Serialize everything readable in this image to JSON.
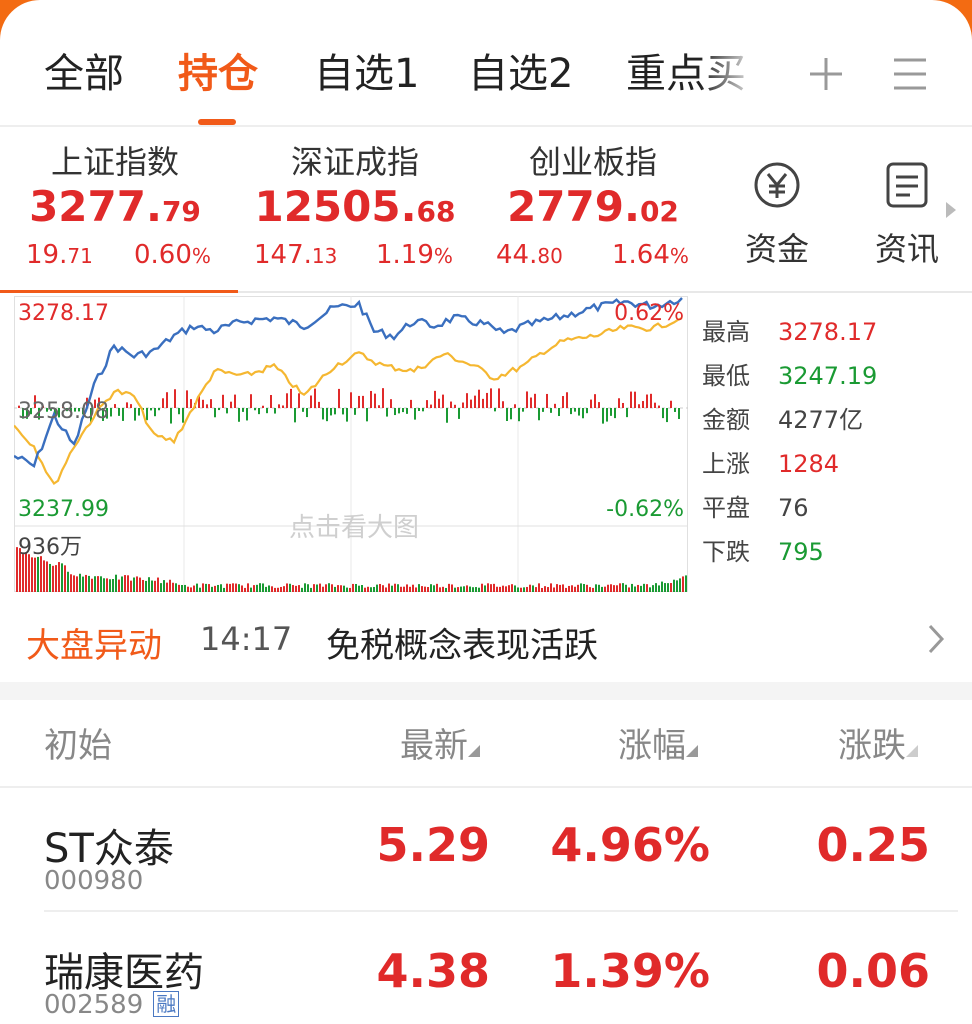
{
  "tabs": [
    {
      "label": "全部",
      "active": false
    },
    {
      "label": "持仓",
      "active": true
    },
    {
      "label": "自选1",
      "active": false
    },
    {
      "label": "自选2",
      "active": false
    },
    {
      "label": "重点买",
      "active": false
    }
  ],
  "icons": {
    "add": "plus-icon",
    "menu": "menu-icon",
    "capital": "yen-icon",
    "news": "document-icon"
  },
  "indices": [
    {
      "name": "上证指数",
      "price_int": "3277.",
      "price_dec": "79",
      "chg_int": "19.",
      "chg_dec": "71",
      "pct": "0.60",
      "pct_sign": "%"
    },
    {
      "name": "深证成指",
      "price_int": "12505.",
      "price_dec": "68",
      "chg_int": "147.",
      "chg_dec": "13",
      "pct": "1.19",
      "pct_sign": "%"
    },
    {
      "name": "创业板指",
      "price_int": "2779.",
      "price_dec": "02",
      "chg_int": "44.",
      "chg_dec": "80",
      "pct": "1.64",
      "pct_sign": "%"
    }
  ],
  "side_buttons": {
    "capital": "资金",
    "news": "资讯"
  },
  "chart": {
    "high_label": "3278.17",
    "mid_label": "3258.08",
    "low_label": "3237.99",
    "pos_pct": "0.62%",
    "neg_pct": "-0.62%",
    "volume_label": "936万",
    "watermark": "点击看大图"
  },
  "stats": [
    {
      "label": "最高",
      "value": "3278.17",
      "color": "#e02a2a"
    },
    {
      "label": "最低",
      "value": "3247.19",
      "color": "#1a9a33"
    },
    {
      "label": "金额",
      "value": "4277亿",
      "color": "#444444"
    },
    {
      "label": "上涨",
      "value": "1284",
      "color": "#e02a2a"
    },
    {
      "label": "平盘",
      "value": "76",
      "color": "#444444"
    },
    {
      "label": "下跌",
      "value": "795",
      "color": "#1a9a33"
    }
  ],
  "alert": {
    "title": "大盘异动",
    "time": "14:17",
    "text": "免税概念表现活跃"
  },
  "table": {
    "headers": {
      "name": "初始",
      "latest": "最新",
      "change_pct": "涨幅",
      "change": "涨跌"
    },
    "rows": [
      {
        "name": "ST众泰",
        "code": "000980",
        "tag": "",
        "latest": "5.29",
        "change_pct": "4.96%",
        "change": "0.25"
      },
      {
        "name": "瑞康医药",
        "code": "002589",
        "tag": "融",
        "latest": "4.38",
        "change_pct": "1.39%",
        "change": "0.06"
      }
    ]
  },
  "colors": {
    "accent": "#f15a19",
    "up": "#e02a2a",
    "down": "#1a9a33",
    "line_index": "#3a6fbf",
    "line_avg": "#f5b731"
  }
}
